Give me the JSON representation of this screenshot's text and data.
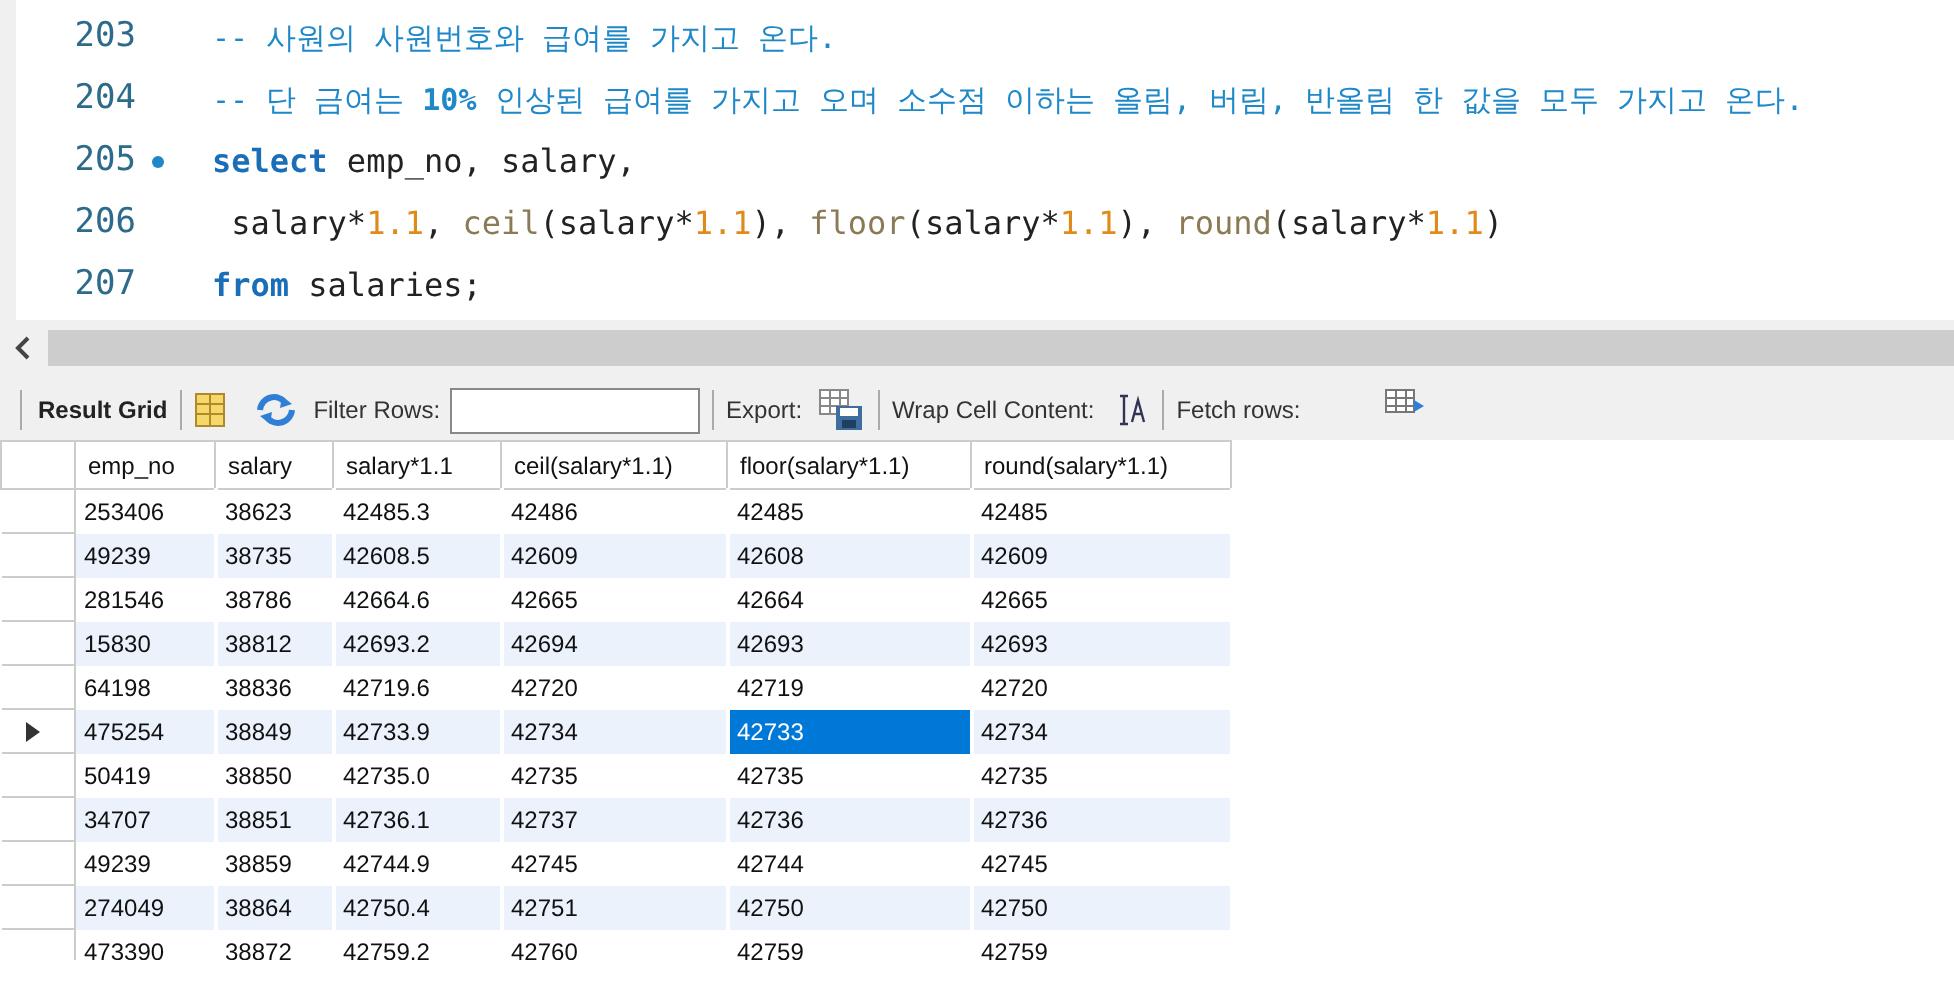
{
  "editor": {
    "lines": [
      {
        "number": "203",
        "marked": false,
        "tokens": [
          {
            "kind": "comment",
            "text": "-- 사원의 사원번호와 급여를 가지고 온다."
          }
        ]
      },
      {
        "number": "204",
        "marked": false,
        "tokens": [
          {
            "kind": "comment",
            "text": "-- 단 금여는 "
          },
          {
            "kind": "comment-bold",
            "text": "10%"
          },
          {
            "kind": "comment",
            "text": " 인상된 급여를 가지고 오며 소수점 이하는 올림, 버림, 반올림 한 값을 모두 가지고 온다."
          }
        ]
      },
      {
        "number": "205",
        "marked": true,
        "tokens": [
          {
            "kind": "keyword",
            "text": "select"
          },
          {
            "kind": "plain",
            "text": " emp_no, salary,"
          }
        ]
      },
      {
        "number": "206",
        "marked": false,
        "tokens": [
          {
            "kind": "plain",
            "text": " salary*"
          },
          {
            "kind": "number",
            "text": "1.1"
          },
          {
            "kind": "plain",
            "text": ", "
          },
          {
            "kind": "function",
            "text": "ceil"
          },
          {
            "kind": "plain",
            "text": "(salary*"
          },
          {
            "kind": "number",
            "text": "1.1"
          },
          {
            "kind": "plain",
            "text": "), "
          },
          {
            "kind": "function",
            "text": "floor"
          },
          {
            "kind": "plain",
            "text": "(salary*"
          },
          {
            "kind": "number",
            "text": "1.1"
          },
          {
            "kind": "plain",
            "text": "), "
          },
          {
            "kind": "function",
            "text": "round"
          },
          {
            "kind": "plain",
            "text": "(salary*"
          },
          {
            "kind": "number",
            "text": "1.1"
          },
          {
            "kind": "plain",
            "text": ")"
          }
        ]
      },
      {
        "number": "207",
        "marked": false,
        "tokens": [
          {
            "kind": "keyword",
            "text": "from"
          },
          {
            "kind": "plain",
            "text": " salaries;"
          }
        ]
      }
    ]
  },
  "toolbar": {
    "result_grid": "Result Grid",
    "filter_label": "Filter Rows:",
    "export_label": "Export:",
    "wrap_label": "Wrap Cell Content:",
    "fetch_label": "Fetch rows:"
  },
  "table": {
    "columns": [
      "emp_no",
      "salary",
      "salary*1.1",
      "ceil(salary*1.1)",
      "floor(salary*1.1)",
      "round(salary*1.1)"
    ],
    "rows": [
      {
        "current": false,
        "cells": [
          {
            "text": "253406",
            "selected": false
          },
          {
            "text": "38623",
            "selected": false
          },
          {
            "text": "42485.3",
            "selected": false
          },
          {
            "text": "42486",
            "selected": false
          },
          {
            "text": "42485",
            "selected": false
          },
          {
            "text": "42485",
            "selected": false
          }
        ]
      },
      {
        "current": false,
        "cells": [
          {
            "text": "49239",
            "selected": false
          },
          {
            "text": "38735",
            "selected": false
          },
          {
            "text": "42608.5",
            "selected": false
          },
          {
            "text": "42609",
            "selected": false
          },
          {
            "text": "42608",
            "selected": false
          },
          {
            "text": "42609",
            "selected": false
          }
        ]
      },
      {
        "current": false,
        "cells": [
          {
            "text": "281546",
            "selected": false
          },
          {
            "text": "38786",
            "selected": false
          },
          {
            "text": "42664.6",
            "selected": false
          },
          {
            "text": "42665",
            "selected": false
          },
          {
            "text": "42664",
            "selected": false
          },
          {
            "text": "42665",
            "selected": false
          }
        ]
      },
      {
        "current": false,
        "cells": [
          {
            "text": "15830",
            "selected": false
          },
          {
            "text": "38812",
            "selected": false
          },
          {
            "text": "42693.2",
            "selected": false
          },
          {
            "text": "42694",
            "selected": false
          },
          {
            "text": "42693",
            "selected": false
          },
          {
            "text": "42693",
            "selected": false
          }
        ]
      },
      {
        "current": false,
        "cells": [
          {
            "text": "64198",
            "selected": false
          },
          {
            "text": "38836",
            "selected": false
          },
          {
            "text": "42719.6",
            "selected": false
          },
          {
            "text": "42720",
            "selected": false
          },
          {
            "text": "42719",
            "selected": false
          },
          {
            "text": "42720",
            "selected": false
          }
        ]
      },
      {
        "current": true,
        "cells": [
          {
            "text": "475254",
            "selected": false
          },
          {
            "text": "38849",
            "selected": false
          },
          {
            "text": "42733.9",
            "selected": false
          },
          {
            "text": "42734",
            "selected": false
          },
          {
            "text": "42733",
            "selected": true
          },
          {
            "text": "42734",
            "selected": false
          }
        ]
      },
      {
        "current": false,
        "cells": [
          {
            "text": "50419",
            "selected": false
          },
          {
            "text": "38850",
            "selected": false
          },
          {
            "text": "42735.0",
            "selected": false
          },
          {
            "text": "42735",
            "selected": false
          },
          {
            "text": "42735",
            "selected": false
          },
          {
            "text": "42735",
            "selected": false
          }
        ]
      },
      {
        "current": false,
        "cells": [
          {
            "text": "34707",
            "selected": false
          },
          {
            "text": "38851",
            "selected": false
          },
          {
            "text": "42736.1",
            "selected": false
          },
          {
            "text": "42737",
            "selected": false
          },
          {
            "text": "42736",
            "selected": false
          },
          {
            "text": "42736",
            "selected": false
          }
        ]
      },
      {
        "current": false,
        "cells": [
          {
            "text": "49239",
            "selected": false
          },
          {
            "text": "38859",
            "selected": false
          },
          {
            "text": "42744.9",
            "selected": false
          },
          {
            "text": "42745",
            "selected": false
          },
          {
            "text": "42744",
            "selected": false
          },
          {
            "text": "42745",
            "selected": false
          }
        ]
      },
      {
        "current": false,
        "cells": [
          {
            "text": "274049",
            "selected": false
          },
          {
            "text": "38864",
            "selected": false
          },
          {
            "text": "42750.4",
            "selected": false
          },
          {
            "text": "42751",
            "selected": false
          },
          {
            "text": "42750",
            "selected": false
          },
          {
            "text": "42750",
            "selected": false
          }
        ]
      },
      {
        "current": false,
        "cells": [
          {
            "text": "473390",
            "selected": false
          },
          {
            "text": "38872",
            "selected": false
          },
          {
            "text": "42759.2",
            "selected": false
          },
          {
            "text": "42760",
            "selected": false
          },
          {
            "text": "42759",
            "selected": false
          },
          {
            "text": "42759",
            "selected": false
          }
        ]
      }
    ]
  }
}
